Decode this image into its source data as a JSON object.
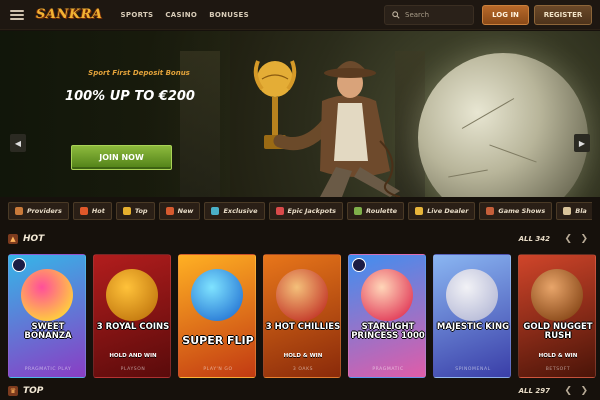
{
  "brand": {
    "logo": "SANKRA"
  },
  "nav": [
    "SPORTS",
    "CASINO",
    "BONUSES"
  ],
  "search": {
    "placeholder": "Search"
  },
  "auth": {
    "login": "LOG IN",
    "register": "REGISTER"
  },
  "hero": {
    "kicker": "Sport First Deposit Bonus",
    "title": "100% UP TO €200",
    "cta": "JOIN NOW",
    "slides_total": 2,
    "slide_active": 2
  },
  "categories": [
    {
      "label": "Providers",
      "icon": "providers-icon",
      "color": "#c97a3a"
    },
    {
      "label": "Hot",
      "icon": "flame-icon",
      "color": "#e0582a"
    },
    {
      "label": "Top",
      "icon": "crown-icon",
      "color": "#e6b02e"
    },
    {
      "label": "New",
      "icon": "new-icon",
      "color": "#d65a2f"
    },
    {
      "label": "Exclusive",
      "icon": "diamond-icon",
      "color": "#4ab0c8"
    },
    {
      "label": "Epic Jackpots",
      "icon": "jackpot-icon",
      "color": "#d94a4a"
    },
    {
      "label": "Roulette",
      "icon": "roulette-icon",
      "color": "#7fb04a"
    },
    {
      "label": "Live Dealer",
      "icon": "star-icon",
      "color": "#e8b53a"
    },
    {
      "label": "Game Shows",
      "icon": "mic-icon",
      "color": "#c65f3a"
    },
    {
      "label": "Bla",
      "icon": "cards-icon",
      "color": "#d9c49a"
    }
  ],
  "sections": {
    "hot": {
      "title": "HOT",
      "all_label": "ALL 342"
    },
    "top": {
      "title": "TOP",
      "all_label": "ALL 297"
    }
  },
  "games": [
    {
      "name": "SWEET BONANZA",
      "sub": "",
      "provider": "PRAGMATIC PLAY",
      "bg": "#35b6e8",
      "bg2": "#8a3dc4",
      "art": "#ff4f9a",
      "art2": "#ffd33a"
    },
    {
      "name": "3 ROYAL COINS",
      "sub": "HOLD AND WIN",
      "provider": "PLAYSON",
      "bg": "#b21d1d",
      "bg2": "#5a0b0b",
      "art": "#ffc23a",
      "art2": "#c47a10"
    },
    {
      "name": "SUPER FLIP",
      "sub": "",
      "provider": "PLAY'N GO",
      "bg": "#ffb023",
      "bg2": "#c23a12",
      "art": "#7fe3ff",
      "art2": "#2a7bd6"
    },
    {
      "name": "3 HOT CHILLIES",
      "sub": "HOLD & WIN",
      "provider": "3 OAKS",
      "bg": "#e8761a",
      "bg2": "#8a2a0a",
      "art": "#f4c07a",
      "art2": "#c43a2a"
    },
    {
      "name": "STARLIGHT PRINCESS 1000",
      "sub": "",
      "provider": "PRAGMATIC",
      "bg": "#3f8ff0",
      "bg2": "#e05ca8",
      "art": "#ffd6b8",
      "art2": "#e23d5a"
    },
    {
      "name": "MAJESTIC KING",
      "sub": "",
      "provider": "SPINOMENAL",
      "bg": "#8ab6f2",
      "bg2": "#3a3ea8",
      "art": "#f2f2f6",
      "art2": "#b8bcd8"
    },
    {
      "name": "GOLD NUGGET RUSH",
      "sub": "HOLD & WIN",
      "provider": "BETSOFT",
      "bg": "#d0452a",
      "bg2": "#4a1408",
      "art": "#e8a56a",
      "art2": "#8a4a1a"
    }
  ]
}
